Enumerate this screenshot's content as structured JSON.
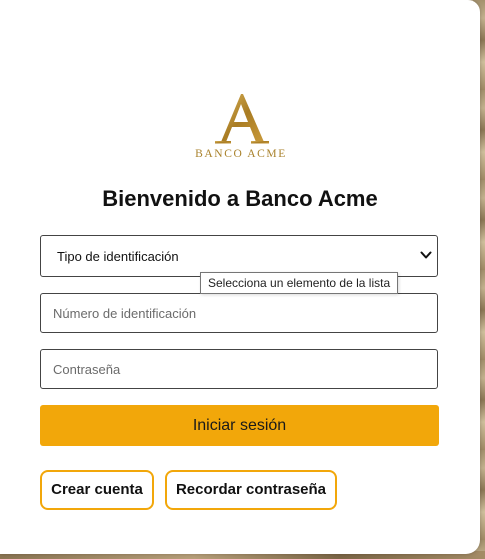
{
  "brand": {
    "logo_letter": "A",
    "logo_text": "BANCO ACME",
    "logo_color": "#a9822c"
  },
  "header": {
    "title": "Bienvenido a Banco Acme"
  },
  "form": {
    "id_type": {
      "selected": "Tipo de identificación",
      "tooltip": "Selecciona un elemento de la lista"
    },
    "id_number": {
      "placeholder": "Número de identificación",
      "value": ""
    },
    "password": {
      "placeholder": "Contraseña",
      "value": ""
    },
    "login_label": "Iniciar sesión"
  },
  "actions": {
    "create_account_label": "Crear cuenta",
    "remember_password_label": "Recordar contraseña"
  },
  "colors": {
    "accent": "#f2a70a",
    "text": "#111111",
    "card": "#ffffff"
  },
  "icons": {
    "select_arrow": "chevron-down-icon"
  }
}
